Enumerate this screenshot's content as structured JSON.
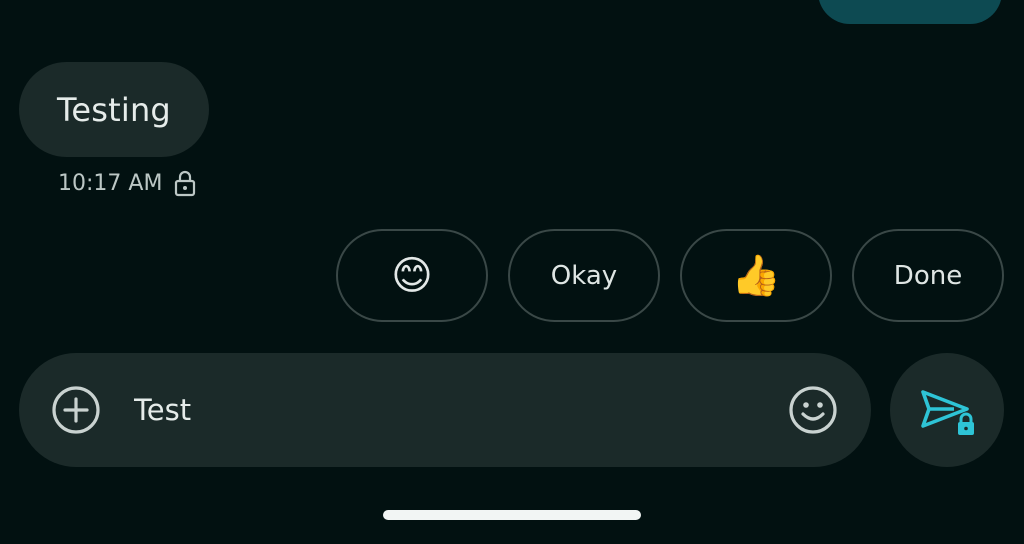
{
  "conversation": {
    "incoming_message": {
      "text": "Testing",
      "timestamp": "10:17 AM",
      "status_icon": "lock-icon"
    }
  },
  "smart_replies": [
    {
      "type": "emoji",
      "label": "😊",
      "icon": "smiling-face-emoji"
    },
    {
      "type": "text",
      "label": "Okay"
    },
    {
      "type": "emoji",
      "label": "👍",
      "icon": "thumbs-up-emoji"
    },
    {
      "type": "text",
      "label": "Done"
    }
  ],
  "composer": {
    "input_value": "Test",
    "add_icon": "add-circle-icon",
    "emoji_icon": "emoji-smiley-icon",
    "send_icon": "send-encrypted-icon"
  },
  "colors": {
    "background": "#021111",
    "bubble": "#1b2a29",
    "outgoing_bubble": "#0d4a52",
    "accent": "#2ec4d6",
    "chip_border": "#3a4847"
  }
}
